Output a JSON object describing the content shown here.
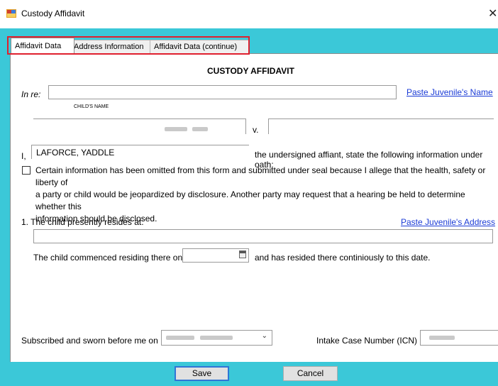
{
  "window": {
    "title": "Custody Affidavit",
    "close_glyph": "✕",
    "icon": "form-icon"
  },
  "tabs": [
    {
      "label": "Affidavit Data",
      "active": true
    },
    {
      "label": "Address Information",
      "active": false
    },
    {
      "label": "Affidavit Data (continue)",
      "active": false
    }
  ],
  "form": {
    "heading": "CUSTODY AFFIDAVIT",
    "in_re_label": "In re:",
    "in_re_value": "",
    "child_name_caption": "CHILD'S NAME",
    "paste_name_link": "Paste Juvenile's Name",
    "versus_label": "v.",
    "versus_value": "",
    "i_label": "I,",
    "affiant_name": "LAFORCE, YADDLE",
    "oath_text": "the undersigned affiant, state the following information under oath:",
    "seal_checkbox_checked": false,
    "seal_text_line1": "Certain information has been omitted from this form and submitted under seal because I allege that the health, safety or liberty of",
    "seal_text_line2": "a party or child would be jeopardized by disclosure. Another party may request that a hearing be held to determine whether this",
    "seal_text_line3": "information should be disclosed.",
    "resides_label": "1.  The child presently resides at:",
    "paste_address_link": "Paste Juvenile's Address",
    "address_value": "",
    "commenced_label": "The child commenced residing there on",
    "commenced_value": "",
    "resided_text": "and has resided there continiously to this date.",
    "subscribed_label": "Subscribed and sworn before me on",
    "intake_label": "Intake Case Number (ICN)"
  },
  "buttons": {
    "save": "Save",
    "cancel": "Cancel"
  },
  "colors": {
    "frame": "#3bc8d8",
    "link": "#1a3bd6",
    "highlight": "#e0202e"
  }
}
